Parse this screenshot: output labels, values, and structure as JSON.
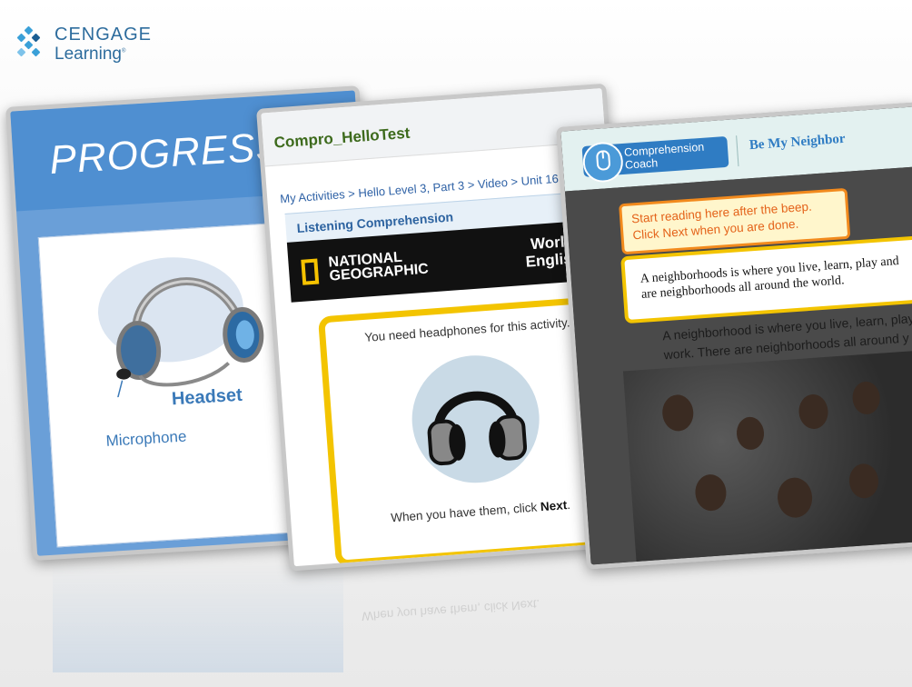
{
  "brand": {
    "line1": "CENGAGE",
    "line2": "Learning",
    "reg": "®"
  },
  "card1": {
    "title": "PROGRESS TE",
    "headset_label": "Headset",
    "microphone_label": "Microphone"
  },
  "card2": {
    "app_title": "Compro_HelloTest",
    "breadcrumb": "My Activities > Hello Level 3, Part 3 > Video > Unit 16 >",
    "section_title": "Listening Comprehension",
    "brand_left": "NATIONAL\nGEOGRAPHIC",
    "brand_right": "World\nEnglish",
    "need_text": "You need headphones for this activity.",
    "when_text": "When you have them, click ",
    "when_bold": "Next",
    "when_end": "."
  },
  "card3": {
    "coach_label": "Comprehension\nCoach",
    "lesson_title": "Be My Neighbor",
    "tip": "Start reading here after the beep.\nClick Next when you are done.",
    "quote_line1": "A neighborhoods is where you live, learn, play and",
    "quote_line2": "are neighborhoods all around the world.",
    "dark_line1": "A neighborhood is where you live, learn, play",
    "dark_line2": "work. There are neighborhoods all around y"
  },
  "reflection_text": "When you have them, click Next."
}
